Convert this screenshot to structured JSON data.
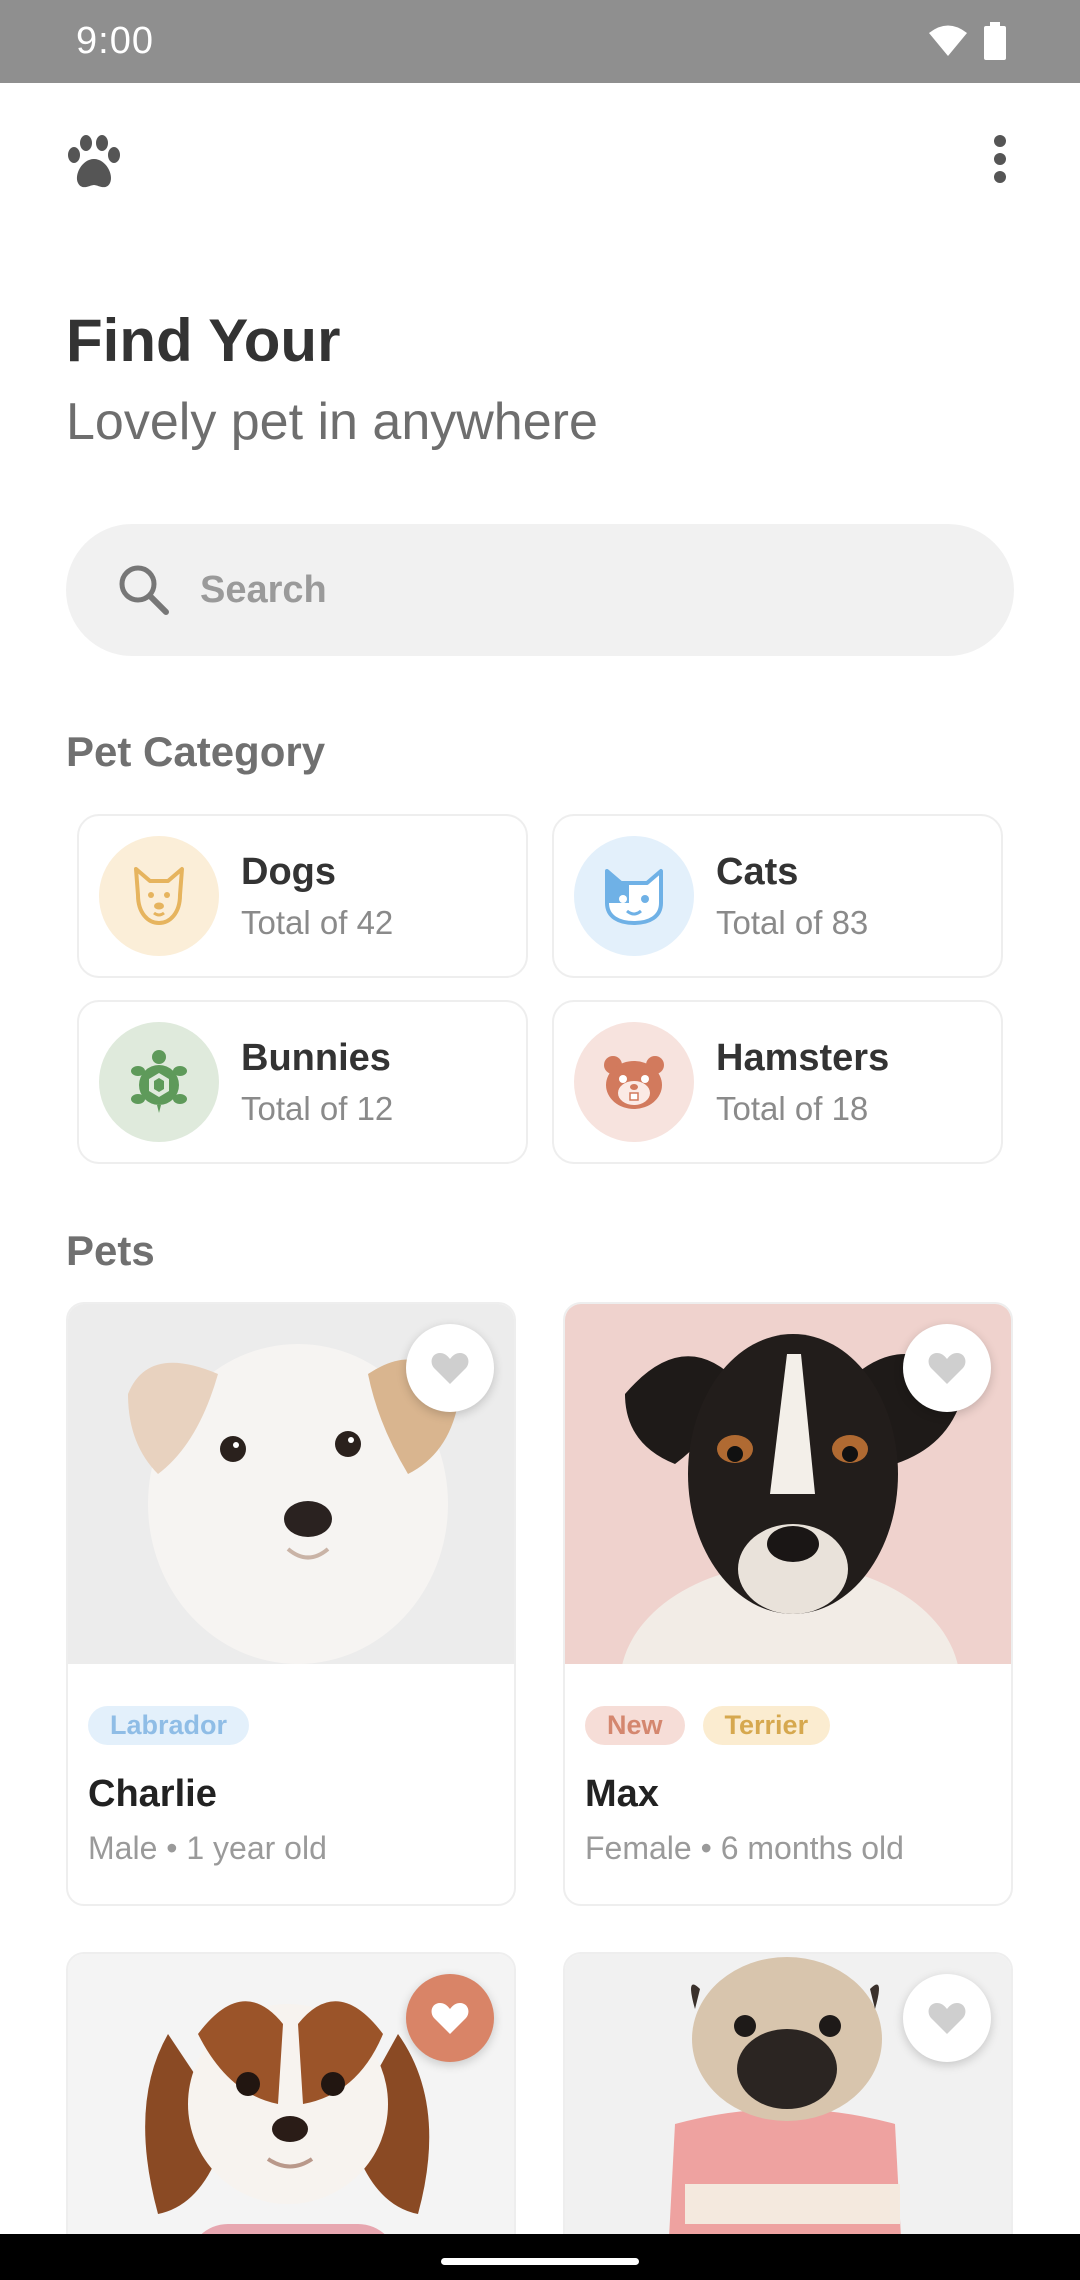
{
  "status_bar": {
    "time": "9:00"
  },
  "header": {
    "title": "Find Your",
    "subtitle": "Lovely pet in anywhere"
  },
  "search": {
    "placeholder": "Search",
    "value": ""
  },
  "category_section": {
    "title": "Pet Category",
    "items": [
      {
        "name": "Dogs",
        "count": "Total of 42",
        "icon": "dog-icon",
        "color": "#e6b45e",
        "bg": "#fbeed8"
      },
      {
        "name": "Cats",
        "count": "Total of 83",
        "icon": "cat-icon",
        "color": "#6fb1e6",
        "bg": "#e3f0fb"
      },
      {
        "name": "Bunnies",
        "count": "Total of 12",
        "icon": "turtle-icon",
        "color": "#5e9a5a",
        "bg": "#dfeadc"
      },
      {
        "name": "Hamsters",
        "count": "Total of 18",
        "icon": "hamster-icon",
        "color": "#d27a5d",
        "bg": "#f7e3de"
      }
    ]
  },
  "pets_section": {
    "title": "Pets",
    "items": [
      {
        "name": "Charlie",
        "meta": "Male • 1 year old",
        "tags": [
          "Labrador"
        ],
        "favorite": false
      },
      {
        "name": "Max",
        "meta": "Female • 6 months old",
        "tags": [
          "New",
          "Terrier"
        ],
        "favorite": false
      },
      {
        "name": "",
        "meta": "",
        "tags": [],
        "favorite": true
      },
      {
        "name": "",
        "meta": "",
        "tags": [],
        "favorite": false
      }
    ]
  },
  "colors": {
    "accent": "#d98467",
    "background": "#ffffff",
    "status_bar": "#8f8f8f"
  }
}
